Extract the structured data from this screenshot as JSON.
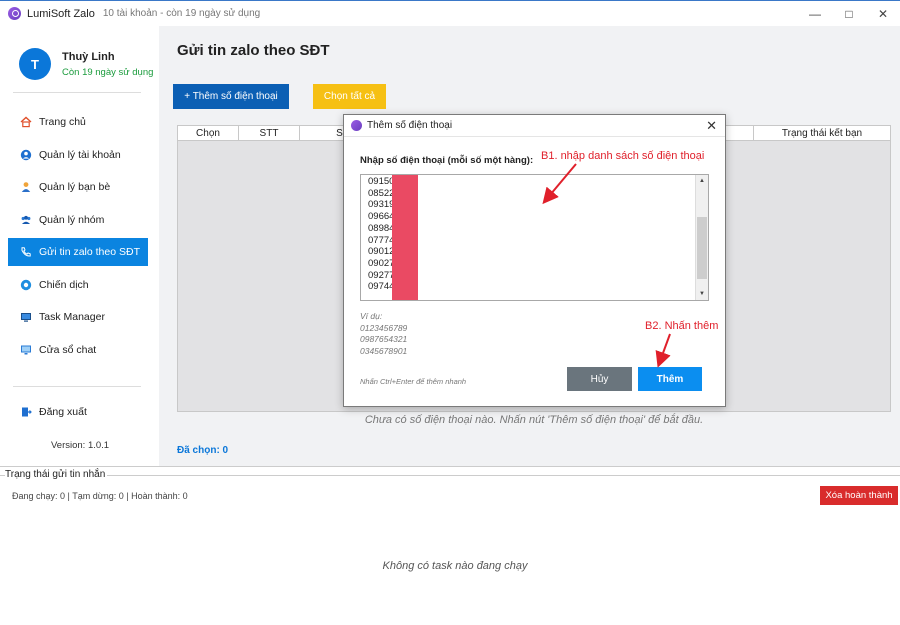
{
  "window": {
    "app_name": "LumiSoft Zalo",
    "subtitle": "10 tài khoản - còn 19 ngày sử dụng"
  },
  "user": {
    "initial": "T",
    "name": "Thuỳ Linh",
    "status": "Còn 19 ngày sử dụng"
  },
  "sidebar": {
    "items": [
      {
        "label": "Trang chủ",
        "icon": "home-icon"
      },
      {
        "label": "Quản lý tài khoản",
        "icon": "user-icon"
      },
      {
        "label": "Quản lý bạn bè",
        "icon": "person-icon"
      },
      {
        "label": "Quản lý nhóm",
        "icon": "group-icon"
      },
      {
        "label": "Gửi tin zalo theo SĐT",
        "icon": "phone-icon"
      },
      {
        "label": "Chiến dịch",
        "icon": "campaign-icon"
      },
      {
        "label": "Task Manager",
        "icon": "monitor-icon"
      },
      {
        "label": "Cửa sổ chat",
        "icon": "chat-window-icon"
      }
    ],
    "logout": "Đăng xuất",
    "version": "Version: 1.0.1"
  },
  "main": {
    "title": "Gửi tin zalo theo SĐT",
    "add_button": "+ Thêm số điện thoại",
    "select_all_button": "Chọn tất cả",
    "table_columns": [
      "Chọn",
      "STT",
      "S",
      "Trạng thái kết bạn"
    ],
    "empty_message": "Chưa có số điện thoại nào. Nhấn nút 'Thêm số điện thoại' để bắt đầu.",
    "selected_count": "Đã chọn: 0"
  },
  "status_panel": {
    "title": "Trạng thái gửi tin nhắn",
    "counts": "Đang chạy: 0  |  Tạm dừng: 0  |  Hoàn thành: 0",
    "clear_button": "Xóa hoàn thành",
    "no_task": "Không có task nào đang chạy"
  },
  "dialog": {
    "title": "Thêm số điện thoại",
    "label": "Nhập số điện thoại (mỗi số một hàng):",
    "phones": [
      "09150",
      "08522",
      "09319",
      "09664",
      "08984",
      "07774",
      "09012",
      "09027",
      "09277",
      "09744"
    ],
    "example_title": "Ví dụ:",
    "examples": [
      "0123456789",
      "0987654321",
      "0345678901"
    ],
    "hint": "Nhấn Ctrl+Enter để thêm nhanh",
    "cancel_button": "Hủy",
    "ok_button": "Thêm"
  },
  "annotations": {
    "step1": "B1. nhập danh sách số điện thoại",
    "step2": "B2. Nhấn thêm"
  },
  "colors": {
    "primary": "#0b84e0",
    "dark_blue": "#0b5fb4",
    "yellow": "#f6c013",
    "danger": "#d92c2c",
    "redaction": "#ea4a63",
    "annotation": "#e0202b"
  }
}
